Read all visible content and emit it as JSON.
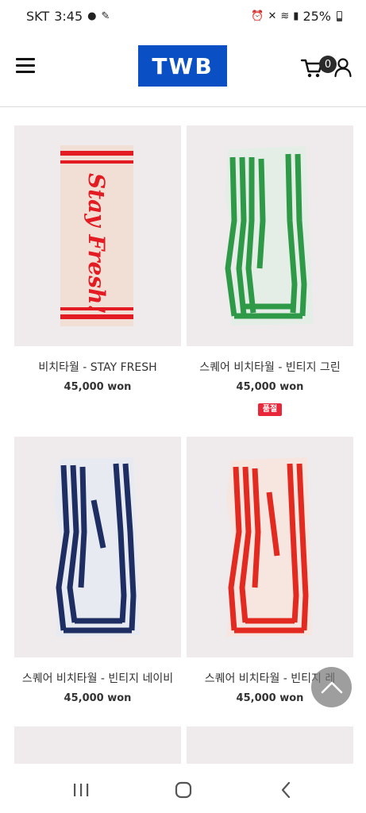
{
  "status_bar": {
    "carrier": "SKT",
    "time": "3:45",
    "battery": "25%"
  },
  "header": {
    "logo": "TWB",
    "cart_count": "0"
  },
  "products": [
    {
      "name": "비치타월 - STAY FRESH",
      "price": "45,000 won",
      "badge": ""
    },
    {
      "name": "스퀘어 비치타월 - 빈티지 그린",
      "price": "45,000 won",
      "badge": "품절"
    },
    {
      "name": "스퀘어 비치타월 - 빈티지 네이비",
      "price": "45,000 won",
      "badge": ""
    },
    {
      "name": "스퀘어 비치타월 - 빈티지 레",
      "price": "45,000 won",
      "badge": ""
    }
  ],
  "product_images": [
    {
      "icon": "stay-fresh-towel",
      "text": "Stay Fresh!",
      "stripe_color": "#e31b23",
      "base_color": "#f1dfd5"
    },
    {
      "icon": "green-square-towel",
      "stripe_color": "#2e9a48",
      "base_color": "#e4eee7"
    },
    {
      "icon": "navy-square-towel",
      "stripe_color": "#1e2d62",
      "base_color": "#e7eaf0"
    },
    {
      "icon": "red-square-towel",
      "stripe_color": "#e32a20",
      "base_color": "#f7e5df"
    }
  ],
  "colors": {
    "brand_blue": "#0a4fc4",
    "soldout_red": "#e8273a"
  }
}
